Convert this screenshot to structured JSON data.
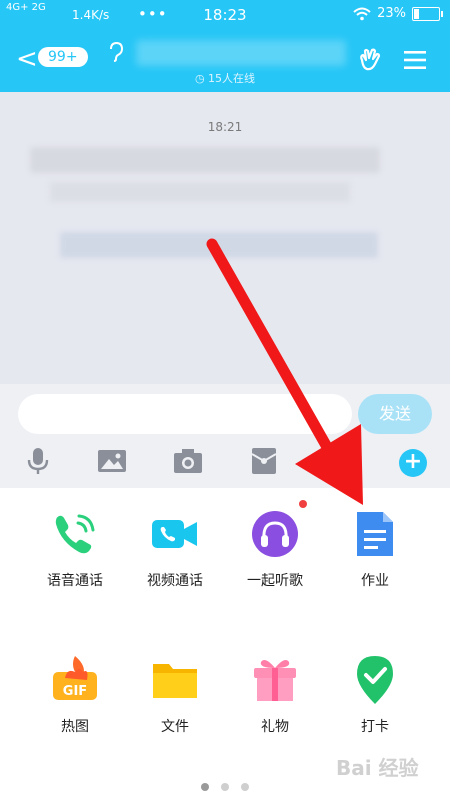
{
  "status_bar": {
    "network": "4G+ 2G",
    "speed": "1.4K/s",
    "dots": "•••",
    "time": "18:23",
    "battery": "23%",
    "battery_level": 0.23
  },
  "header": {
    "back_symbol": "<",
    "unread_badge": "99+",
    "online_text": "15人在线"
  },
  "chat": {
    "message_time": "18:21"
  },
  "input": {
    "placeholder": "",
    "send_label": "发送"
  },
  "tools": [
    "microphone-icon",
    "image-icon",
    "camera-icon",
    "red-packet-icon",
    "emoji-icon"
  ],
  "apps": [
    {
      "label": "语音通话",
      "icon": "phone-call-icon"
    },
    {
      "label": "视频通话",
      "icon": "video-call-icon"
    },
    {
      "label": "一起听歌",
      "icon": "headphones-icon",
      "notification": true
    },
    {
      "label": "作业",
      "icon": "homework-doc-icon"
    },
    {
      "label": "热图",
      "icon": "hot-gif-icon"
    },
    {
      "label": "文件",
      "icon": "folder-icon"
    },
    {
      "label": "礼物",
      "icon": "gift-icon"
    },
    {
      "label": "打卡",
      "icon": "check-in-icon"
    }
  ],
  "pager": {
    "pages": 3,
    "active": 1
  },
  "colors": {
    "accent": "#26c6f6",
    "send_disabled": "#a9e2f7",
    "arrow": "#f01818"
  },
  "watermark": "Bai 经验"
}
